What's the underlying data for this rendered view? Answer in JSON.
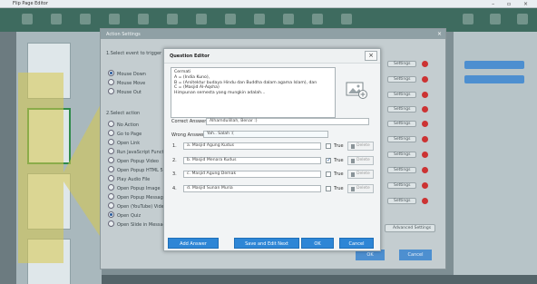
{
  "app": {
    "window_title": "Flip Page Editor"
  },
  "action_settings": {
    "title": "Action Settings",
    "section1": "1.Select event to trigger action",
    "events": [
      "Mouse Down",
      "Mouse Move",
      "Mouse Out"
    ],
    "section2": "2.Select action",
    "actions": [
      "No Action",
      "Go to Page",
      "Open Link",
      "Run JavaScript Function",
      "Open Popup Video",
      "Open Popup HTML 5",
      "Play Audio File",
      "Open Popup Image",
      "Open Popup Message",
      "Open (YouTube) Video",
      "Open Quiz",
      "Open Slide in Message"
    ],
    "settings_label": "Settings",
    "advanced_label": "Advanced Settings",
    "ok_label": "OK",
    "cancel_label": "Cancel"
  },
  "question_editor": {
    "title": "Question Editor",
    "close_glyph": "×",
    "question_text": "Cermati\nA = (India Kuno),\nB = (Arsitektur budaya Hindu dan Buddha dalam agama Islam), dan\nC = (Masjid Al-Aqsha)\nHimpunan semesta yang mungkin adalah...",
    "correct_answer_label": "Correct Answer:",
    "correct_answer_value": "Alhamdulillah, Benar :)",
    "wrong_answer_label": "Wrong Answer:",
    "wrong_answer_value": "Yah.. Salah :(",
    "answers": [
      {
        "num": "1.",
        "text": "a. Masjid Agung Kudus",
        "true": false
      },
      {
        "num": "2.",
        "text": "b. Masjid Menara Kudus",
        "true": true
      },
      {
        "num": "3.",
        "text": "c. Masjid Agung Demak",
        "true": false
      },
      {
        "num": "4.",
        "text": "d. Masjid Sunan Muria",
        "true": false
      }
    ],
    "true_label": "True",
    "delete_label": "Delete",
    "buttons": {
      "add_answer": "Add Answer",
      "save_edit_next": "Save and Edit Next",
      "ok": "OK",
      "cancel": "Cancel"
    }
  },
  "colors": {
    "primary_button": "#2e86d6",
    "toolbar": "#3e6b5f",
    "delete_icon": "#cc3333"
  }
}
